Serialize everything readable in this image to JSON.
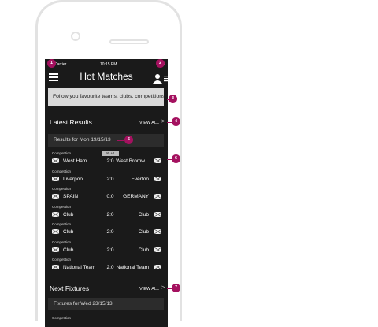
{
  "status_bar": {
    "carrier": "Carrier",
    "time": "10:15 PM"
  },
  "header": {
    "title": "Hot Matches"
  },
  "follow_banner": {
    "text": "Follow you favourite teams, clubs, competitions"
  },
  "latest_results": {
    "title": "Latest Results",
    "view_all": "VIEW ALL",
    "date_label": "Results for Mon 19/15/13"
  },
  "matches": [
    {
      "competition": "Competition",
      "home": "West Ham ...",
      "score": "2:0",
      "away": "West Bromw...",
      "live": "90 +1"
    },
    {
      "competition": "Competition",
      "home": "Liverpool",
      "score": "2:0",
      "away": "Everton"
    },
    {
      "competition": "Competition",
      "home": "SPAIN",
      "score": "0:0",
      "away": "GERMANY"
    },
    {
      "competition": "Competition",
      "home": "Club",
      "score": "2:0",
      "away": "Club"
    },
    {
      "competition": "Competition",
      "home": "Club",
      "score": "2:0",
      "away": "Club"
    },
    {
      "competition": "Competition",
      "home": "Club",
      "score": "2:0",
      "away": "Club"
    },
    {
      "competition": "Competition",
      "home": "National Team",
      "score": "2:0",
      "away": "National Team"
    }
  ],
  "next_fixtures": {
    "title": "Next Fixtures",
    "view_all": "VIEW ALL",
    "date_label": "Fixtures for Wed 23/15/13",
    "competition": "Competition"
  },
  "annotations": [
    "1",
    "2",
    "3",
    "4",
    "5",
    "6",
    "7"
  ],
  "colors": {
    "annotation": "#a4115f",
    "screen": "#1a1a1a",
    "banner": "#d9d9d9"
  }
}
